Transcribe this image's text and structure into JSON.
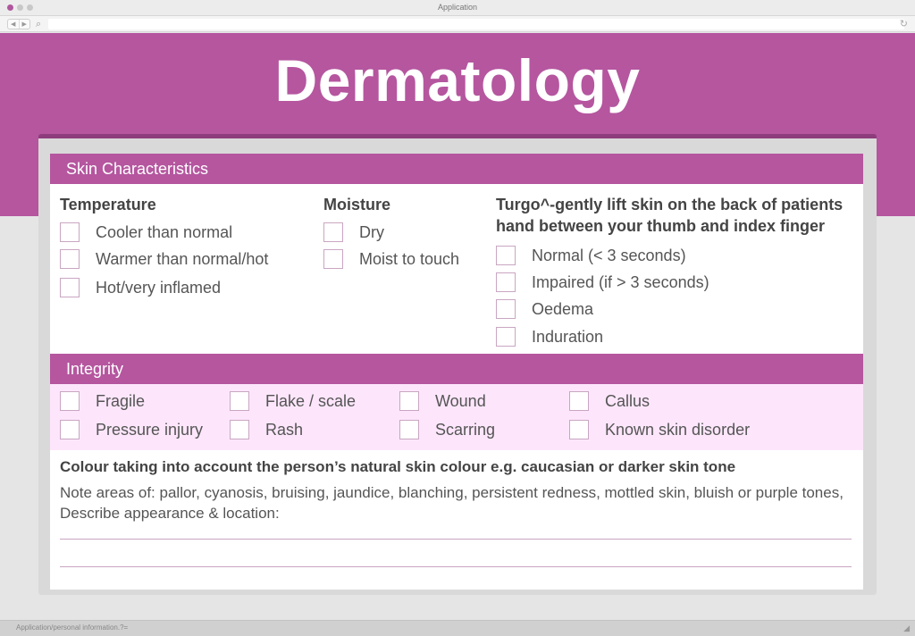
{
  "window": {
    "title": "Application",
    "status_url": "Application/personal information.?="
  },
  "icons": {
    "back": "chevron-left-icon",
    "forward": "chevron-right-icon",
    "search": "search-icon",
    "reload": "reload-icon",
    "grip": "resize-grip-icon"
  },
  "colors": {
    "brand": "#b5569f",
    "brand_dark": "#8e3d7c",
    "integrity_bg": "#fde6fb"
  },
  "page": {
    "title": "Dermatology"
  },
  "skin": {
    "section_title": "Skin Characteristics",
    "temperature": {
      "label": "Temperature",
      "options": [
        "Cooler than normal",
        "Warmer than normal/hot",
        "Hot/very inflamed"
      ]
    },
    "moisture": {
      "label": "Moisture",
      "options": [
        "Dry",
        "Moist to touch"
      ]
    },
    "turgor": {
      "label_line1": "Turgo^-gently lift skin on the back of patients",
      "label_line2": "hand between your thumb and index finger",
      "options": [
        "Normal (< 3 seconds)",
        "Impaired (if > 3 seconds)",
        "Oedema",
        "Induration"
      ]
    }
  },
  "integrity": {
    "section_title": "Integrity",
    "row1": [
      "Fragile",
      "Flake / scale",
      "Wound",
      "Callus"
    ],
    "row2": [
      "Pressure injury",
      "Rash",
      "Scarring",
      "Known skin disorder"
    ]
  },
  "colour": {
    "heading": "Colour taking into account the person’s natural skin colour e.g. caucasian or darker skin tone",
    "description": "Note areas of: pallor, cyanosis, bruising, jaundice, blanching, persistent redness, mottled skin, bluish or purple tones, Describe appearance & location:"
  }
}
